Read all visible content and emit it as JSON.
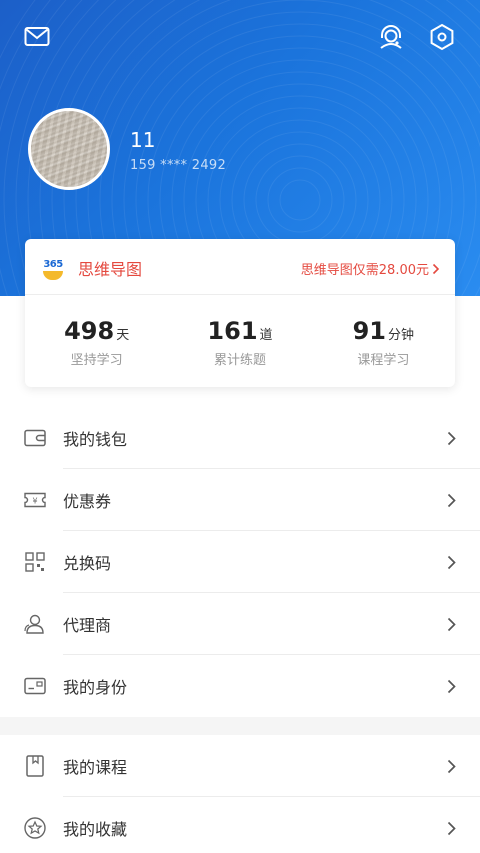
{
  "profile": {
    "name": "11",
    "phone": "159 **** 2492"
  },
  "icons": {
    "mail": "mail-icon",
    "support": "headset-icon",
    "settings": "settings-hex-icon"
  },
  "promo": {
    "badge_number": "365",
    "title": "思维导图",
    "price_text": "思维导图仅需28.00元"
  },
  "stats": [
    {
      "value": "498",
      "unit": "天",
      "label": "坚持学习"
    },
    {
      "value": "161",
      "unit": "道",
      "label": "累计练题"
    },
    {
      "value": "91",
      "unit": "分钟",
      "label": "课程学习"
    }
  ],
  "menu_group_1": [
    {
      "label": "我的钱包",
      "icon": "wallet-icon"
    },
    {
      "label": "优惠券",
      "icon": "coupon-icon"
    },
    {
      "label": "兑换码",
      "icon": "qrcode-icon"
    },
    {
      "label": "代理商",
      "icon": "agent-icon"
    },
    {
      "label": "我的身份",
      "icon": "id-card-icon"
    }
  ],
  "menu_group_2": [
    {
      "label": "我的课程",
      "icon": "book-icon"
    },
    {
      "label": "我的收藏",
      "icon": "star-icon"
    }
  ],
  "colors": {
    "header_blue": "#1b6fd8",
    "promo_red": "#e4493f",
    "text": "#333333",
    "muted": "#999999"
  }
}
